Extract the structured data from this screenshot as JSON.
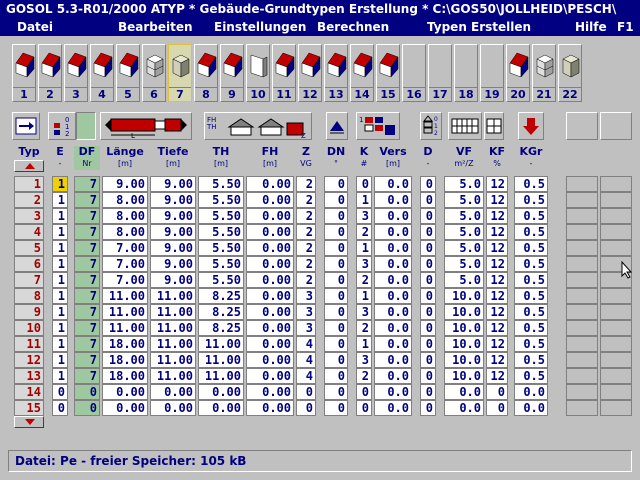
{
  "title": "GOSOL  5.3-R01/2000  ATYP  * Gebäude-Grundtypen Erstellung  *  C:\\GOS50\\JOLLHEID\\PESCH\\",
  "menu": [
    {
      "label": "Datei"
    },
    {
      "label": "Bearbeiten"
    },
    {
      "label": "Einstellungen"
    },
    {
      "label": "Berechnen"
    },
    {
      "label": "Typen  Erstellen"
    },
    {
      "label": "Hilfe"
    },
    {
      "label": "F1"
    }
  ],
  "gallery": [
    {
      "num": "1",
      "icon": "red-roof-house-icon"
    },
    {
      "num": "2",
      "icon": "red-roof-house-icon"
    },
    {
      "num": "3",
      "icon": "red-roof-house-icon"
    },
    {
      "num": "4",
      "icon": "red-roof-house-icon"
    },
    {
      "num": "5",
      "icon": "red-roof-house-icon"
    },
    {
      "num": "6",
      "icon": "stacked-block-icon"
    },
    {
      "num": "7",
      "icon": "gray-block-icon",
      "selected": true
    },
    {
      "num": "8",
      "icon": "red-roof-house-icon"
    },
    {
      "num": "9",
      "icon": "red-roof-house-icon"
    },
    {
      "num": "10",
      "icon": "flat-wall-icon"
    },
    {
      "num": "11",
      "icon": "red-roof-house-icon"
    },
    {
      "num": "12",
      "icon": "red-roof-house-icon"
    },
    {
      "num": "13",
      "icon": "red-roof-house-icon"
    },
    {
      "num": "14",
      "icon": "red-roof-house-icon"
    },
    {
      "num": "15",
      "icon": "red-roof-house-icon"
    },
    {
      "num": "16",
      "icon": ""
    },
    {
      "num": "17",
      "icon": ""
    },
    {
      "num": "18",
      "icon": ""
    },
    {
      "num": "19",
      "icon": ""
    },
    {
      "num": "20",
      "icon": "red-roof-house-icon"
    },
    {
      "num": "21",
      "icon": "stacked-block-icon"
    },
    {
      "num": "22",
      "icon": "gray-block-icon"
    }
  ],
  "toolbar": {
    "tool1_icon": "arrow-in-box-icon",
    "tool2_icon": "numbered-blocks-icon",
    "tool3_icon": "length-dimension-icon",
    "tool3_label": "L",
    "tool4_icon": "building-section-icon",
    "tool4_labels": [
      "FH",
      "TH",
      "Z"
    ],
    "tool5_icon": "roof-angle-icon",
    "tool6_icon": "grid-blocks-icon",
    "tool7_icon": "stacked-pyramid-icon",
    "tool8_icon": "window-pattern-icon",
    "tool9_icon": "square-pattern-icon",
    "tool10_icon": "red-down-arrow-icon"
  },
  "headers": [
    {
      "label": "Typ",
      "sub": ""
    },
    {
      "label": "E",
      "sub": "-"
    },
    {
      "label": "DF",
      "sub": "Nr"
    },
    {
      "label": "Länge",
      "sub": "[m]"
    },
    {
      "label": "Tiefe",
      "sub": "[m]"
    },
    {
      "label": "TH",
      "sub": "[m]"
    },
    {
      "label": "FH",
      "sub": "[m]"
    },
    {
      "label": "Z",
      "sub": "VG"
    },
    {
      "label": "DN",
      "sub": "°"
    },
    {
      "label": "K",
      "sub": "#"
    },
    {
      "label": "Vers",
      "sub": "[m]"
    },
    {
      "label": "D",
      "sub": "-"
    },
    {
      "label": "VF",
      "sub": "m²/Z"
    },
    {
      "label": "KF",
      "sub": "%"
    },
    {
      "label": "KGr",
      "sub": "-"
    }
  ],
  "rows": [
    [
      "1",
      "1",
      "7",
      "9.00",
      "9.00",
      "5.50",
      "0.00",
      "2",
      "0",
      "0",
      "0.0",
      "0",
      "5.0",
      "12",
      "0.5"
    ],
    [
      "2",
      "1",
      "7",
      "8.00",
      "9.00",
      "5.50",
      "0.00",
      "2",
      "0",
      "1",
      "0.0",
      "0",
      "5.0",
      "12",
      "0.5"
    ],
    [
      "3",
      "1",
      "7",
      "8.00",
      "9.00",
      "5.50",
      "0.00",
      "2",
      "0",
      "3",
      "0.0",
      "0",
      "5.0",
      "12",
      "0.5"
    ],
    [
      "4",
      "1",
      "7",
      "8.00",
      "9.00",
      "5.50",
      "0.00",
      "2",
      "0",
      "2",
      "0.0",
      "0",
      "5.0",
      "12",
      "0.5"
    ],
    [
      "5",
      "1",
      "7",
      "7.00",
      "9.00",
      "5.50",
      "0.00",
      "2",
      "0",
      "1",
      "0.0",
      "0",
      "5.0",
      "12",
      "0.5"
    ],
    [
      "6",
      "1",
      "7",
      "7.00",
      "9.00",
      "5.50",
      "0.00",
      "2",
      "0",
      "3",
      "0.0",
      "0",
      "5.0",
      "12",
      "0.5"
    ],
    [
      "7",
      "1",
      "7",
      "7.00",
      "9.00",
      "5.50",
      "0.00",
      "2",
      "0",
      "2",
      "0.0",
      "0",
      "5.0",
      "12",
      "0.5"
    ],
    [
      "8",
      "1",
      "7",
      "11.00",
      "11.00",
      "8.25",
      "0.00",
      "3",
      "0",
      "1",
      "0.0",
      "0",
      "10.0",
      "12",
      "0.5"
    ],
    [
      "9",
      "1",
      "7",
      "11.00",
      "11.00",
      "8.25",
      "0.00",
      "3",
      "0",
      "3",
      "0.0",
      "0",
      "10.0",
      "12",
      "0.5"
    ],
    [
      "10",
      "1",
      "7",
      "11.00",
      "11.00",
      "8.25",
      "0.00",
      "3",
      "0",
      "2",
      "0.0",
      "0",
      "10.0",
      "12",
      "0.5"
    ],
    [
      "11",
      "1",
      "7",
      "18.00",
      "11.00",
      "11.00",
      "0.00",
      "4",
      "0",
      "1",
      "0.0",
      "0",
      "10.0",
      "12",
      "0.5"
    ],
    [
      "12",
      "1",
      "7",
      "18.00",
      "11.00",
      "11.00",
      "0.00",
      "4",
      "0",
      "3",
      "0.0",
      "0",
      "10.0",
      "12",
      "0.5"
    ],
    [
      "13",
      "1",
      "7",
      "18.00",
      "11.00",
      "11.00",
      "0.00",
      "4",
      "0",
      "2",
      "0.0",
      "0",
      "10.0",
      "12",
      "0.5"
    ],
    [
      "14",
      "0",
      "0",
      "0.00",
      "0.00",
      "0.00",
      "0.00",
      "0",
      "0",
      "0",
      "0.0",
      "0",
      "0.0",
      "0",
      "0.0"
    ],
    [
      "15",
      "0",
      "0",
      "0.00",
      "0.00",
      "0.00",
      "0.00",
      "0",
      "0",
      "0",
      "0.0",
      "0",
      "0.0",
      "0",
      "0.0"
    ]
  ],
  "selected_cell": {
    "row": 0,
    "col": 1
  },
  "status": "Datei: Pe  -  freier Speicher: 105 kB",
  "colors": {
    "titlebar": "#000080",
    "background": "#c0c0c0",
    "text": "#000080",
    "typ_text": "#a00000",
    "selected": "#f0d000",
    "green": "#a0c8a0"
  }
}
